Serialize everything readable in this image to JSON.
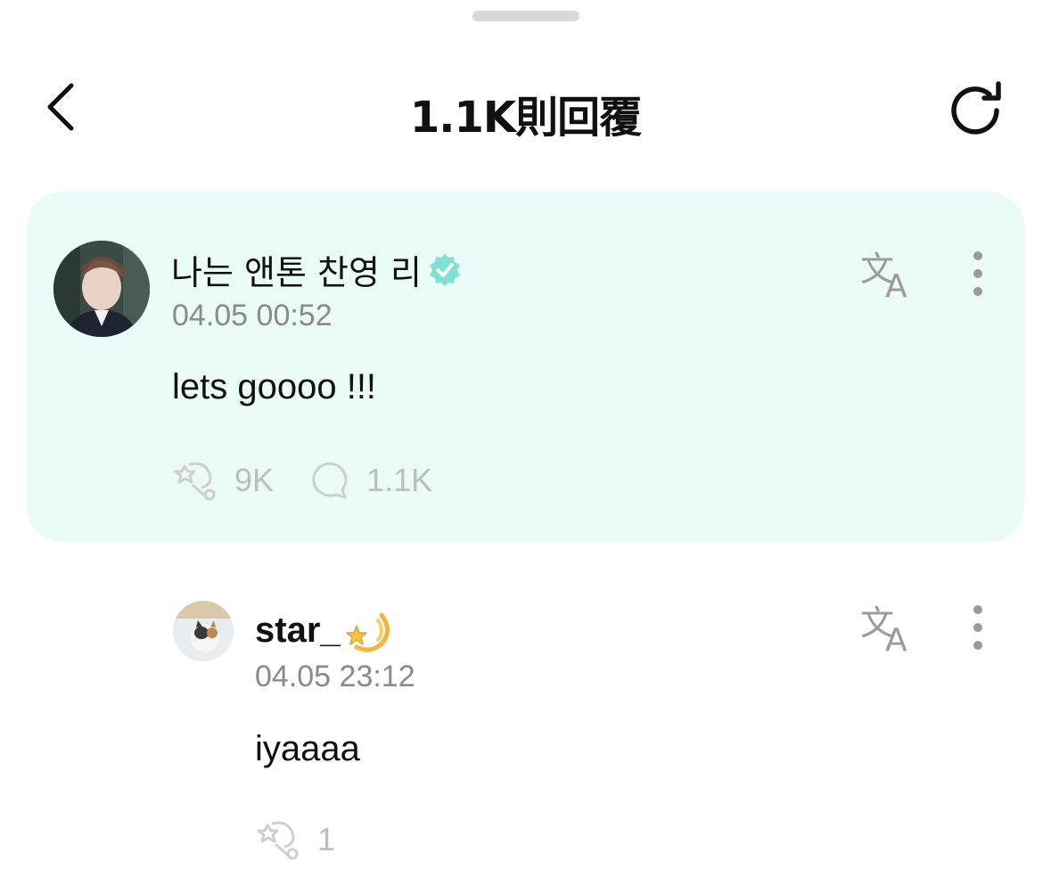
{
  "header": {
    "title": "1.1K則回覆",
    "back_icon": "chevron-left-icon",
    "refresh_icon": "refresh-icon"
  },
  "post": {
    "author": "나는 앤톤 찬영 리",
    "verified": true,
    "timestamp": "04.05 00:52",
    "text": "lets goooo !!!",
    "likes": "9K",
    "replies": "1.1K",
    "background_color": "#eafaf6",
    "verified_color": "#7fe0d6"
  },
  "reply": {
    "author": "star_",
    "author_emoji": "💫",
    "timestamp": "04.05 23:12",
    "text": "iyaaaa",
    "likes": "1"
  }
}
